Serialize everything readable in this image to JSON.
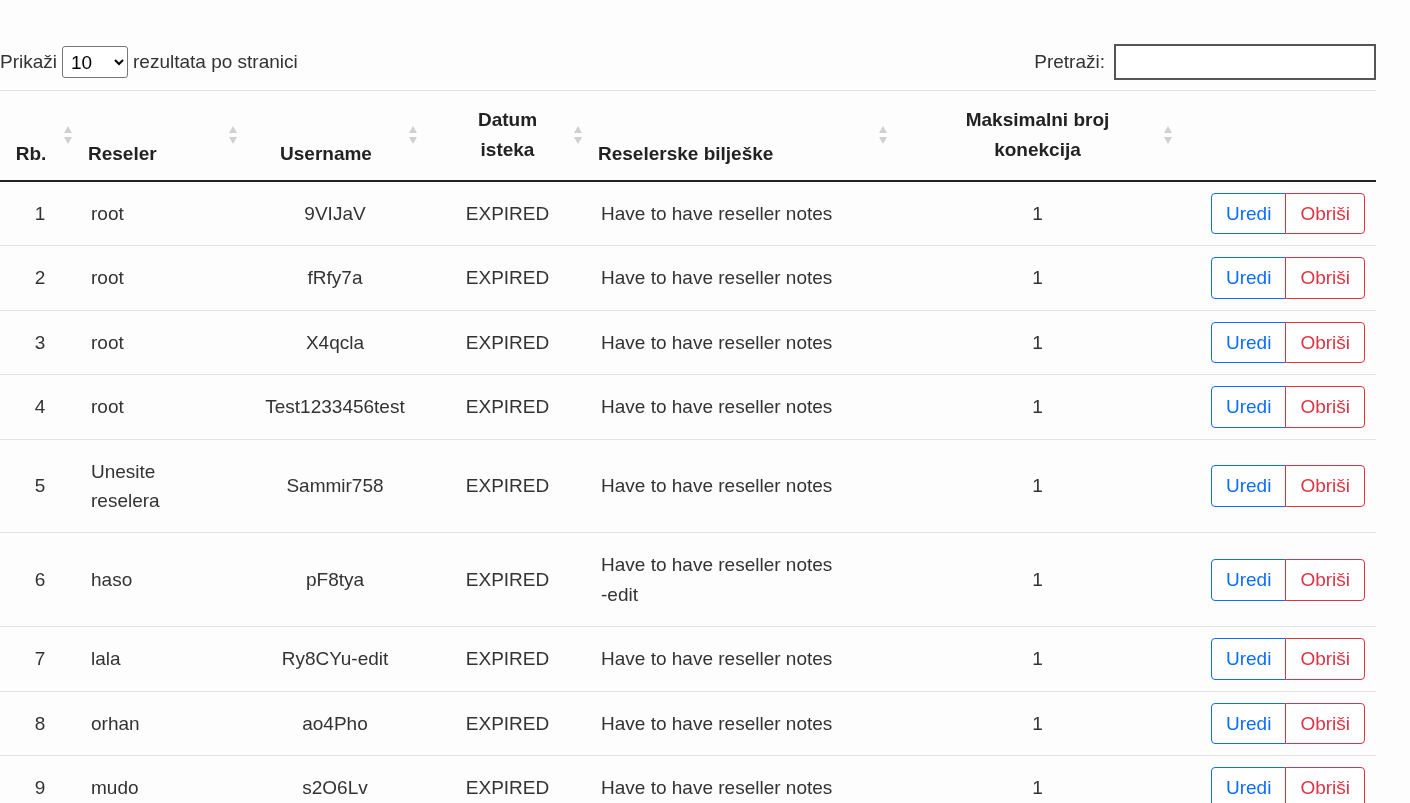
{
  "length_control": {
    "label_before": "Prikaži",
    "value": "10",
    "label_after": "rezultata po stranici"
  },
  "search": {
    "label": "Pretraži:"
  },
  "table": {
    "columns": [
      {
        "label": "Rb.",
        "sortable": true
      },
      {
        "label": "Reseler",
        "sortable": true
      },
      {
        "label": "Username",
        "sortable": true
      },
      {
        "label": "Datum isteka",
        "sortable": true
      },
      {
        "label": "Reselerske bilješke",
        "sortable": true
      },
      {
        "label": "Maksimalni broj konekcija",
        "sortable": true
      }
    ],
    "rows": [
      {
        "rb": "1",
        "reseler": "root",
        "username": "9VIJaV",
        "datum": "EXPIRED",
        "notes": "Have to have reseller notes",
        "max": "1",
        "actions": [
          "Uredi",
          "Obriši"
        ]
      },
      {
        "rb": "2",
        "reseler": "root",
        "username": "fRfy7a",
        "datum": "EXPIRED",
        "notes": "Have to have reseller notes",
        "max": "1",
        "actions": [
          "Uredi",
          "Obriši"
        ]
      },
      {
        "rb": "3",
        "reseler": "root",
        "username": "X4qcla",
        "datum": "EXPIRED",
        "notes": "Have to have reseller notes",
        "max": "1",
        "actions": [
          "Uredi",
          "Obriši"
        ]
      },
      {
        "rb": "4",
        "reseler": "root",
        "username": "Test1233456test",
        "datum": "EXPIRED",
        "notes": "Have to have reseller notes",
        "max": "1",
        "actions": [
          "Uredi",
          "Obriši"
        ]
      },
      {
        "rb": "5",
        "reseler": "Unesite reselera",
        "username": "Sammir758",
        "datum": "EXPIRED",
        "notes": "Have to have reseller notes",
        "max": "1",
        "actions": [
          "Uredi",
          "Obriši"
        ]
      },
      {
        "rb": "6",
        "reseler": "haso",
        "username": "pF8tya",
        "datum": "EXPIRED",
        "notes": "Have to have reseller notes -edit",
        "max": "1",
        "actions": [
          "Uredi",
          "Obriši"
        ]
      },
      {
        "rb": "7",
        "reseler": "lala",
        "username": "Ry8CYu-edit",
        "datum": "EXPIRED",
        "notes": "Have to have reseller notes",
        "max": "1",
        "actions": [
          "Uredi",
          "Obriši"
        ]
      },
      {
        "rb": "8",
        "reseler": "orhan",
        "username": "ao4Pho",
        "datum": "EXPIRED",
        "notes": "Have to have reseller notes",
        "max": "1",
        "actions": [
          "Uredi",
          "Obriši"
        ]
      },
      {
        "rb": "9",
        "reseler": "mudo",
        "username": "s2O6Lv",
        "datum": "EXPIRED",
        "notes": "Have to have reseller notes",
        "max": "1",
        "actions": [
          "Uredi",
          "Obriši"
        ]
      }
    ]
  }
}
